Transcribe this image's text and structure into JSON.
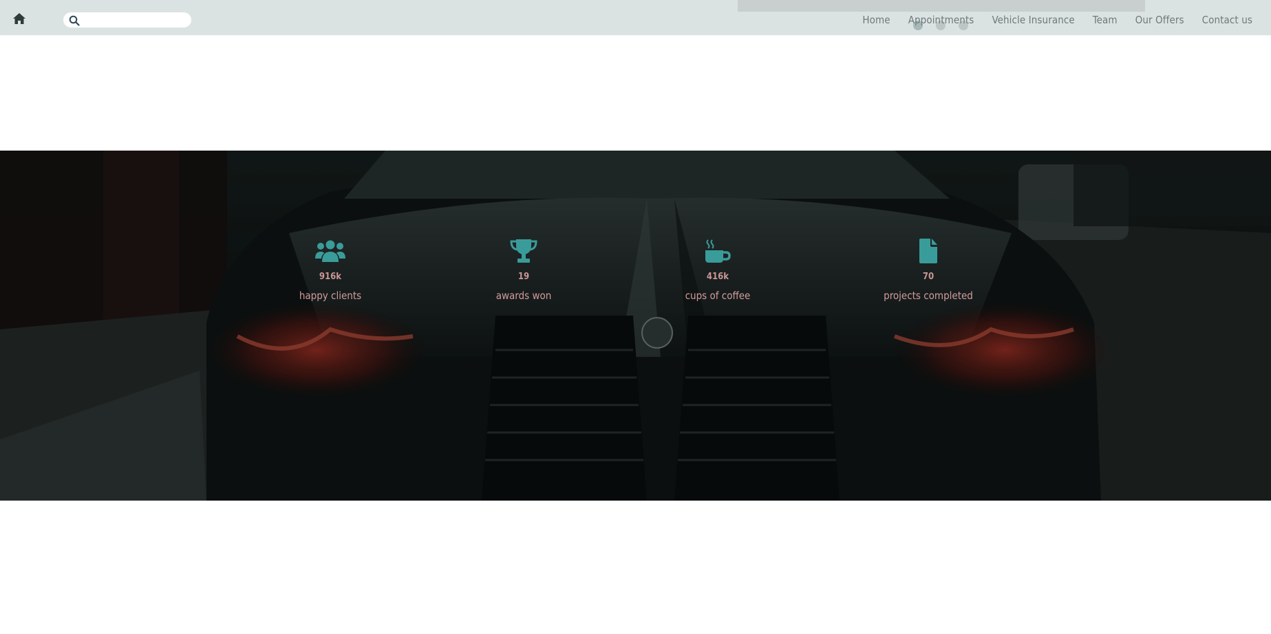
{
  "nav": {
    "home_icon": "home-icon",
    "search": {
      "placeholder": "",
      "value": ""
    },
    "links": [
      "Home",
      "Appointments",
      "Vehicle Insurance",
      "Team",
      "Our Offers",
      "Contact us"
    ]
  },
  "stats": [
    {
      "icon": "users-icon",
      "value": "916k",
      "label": "happy clients"
    },
    {
      "icon": "trophy-icon",
      "value": "19",
      "label": "awards won"
    },
    {
      "icon": "coffee-icon",
      "value": "416k",
      "label": "cups of coffee"
    },
    {
      "icon": "file-icon",
      "value": "70",
      "label": "projects completed"
    }
  ],
  "colors": {
    "navbar_bg": "#dbe3e2",
    "accent_teal": "#3a9c9a",
    "stat_text": "#d29c9c",
    "hero_overlay": "#0e1414"
  }
}
